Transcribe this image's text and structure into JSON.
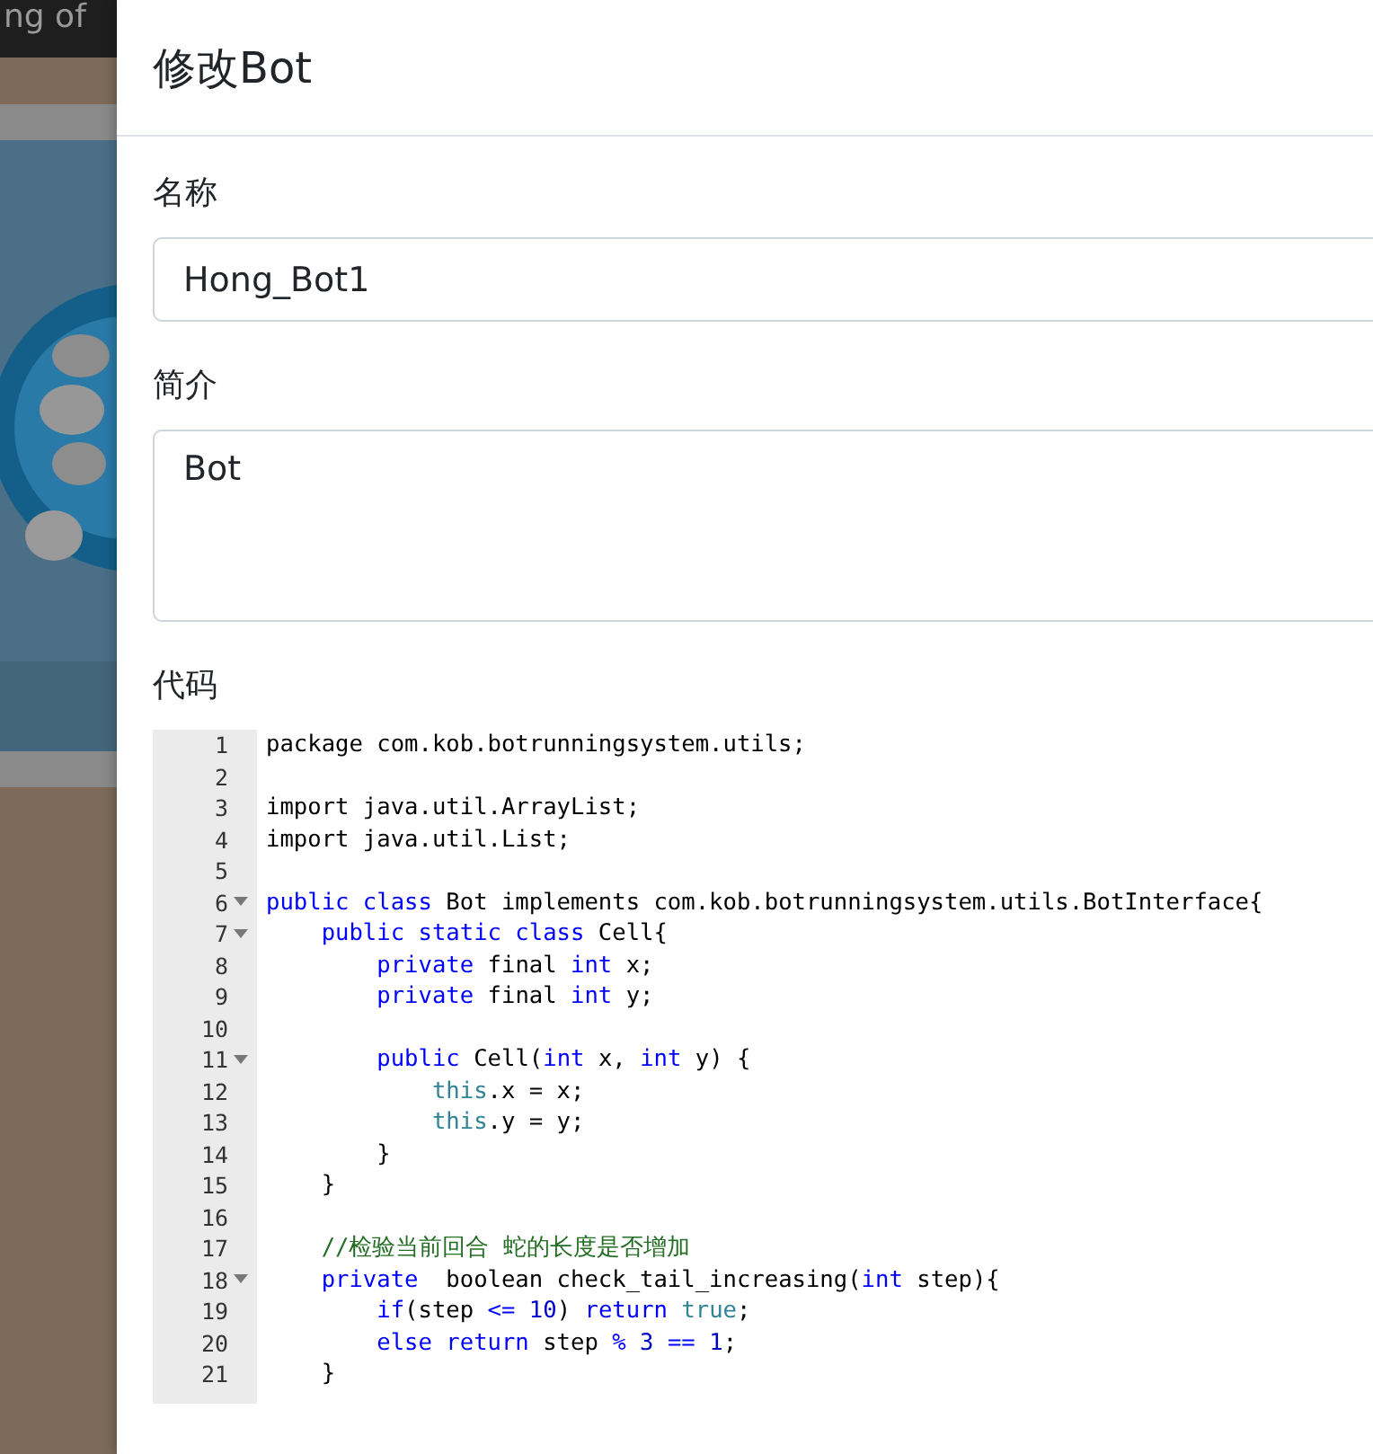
{
  "backdrop": {
    "navbar_text": "ng of"
  },
  "modal": {
    "title": "修改Bot",
    "fields": [
      {
        "label": "名称",
        "kind": "input",
        "value": "Hong_Bot1"
      },
      {
        "label": "简介",
        "kind": "textarea",
        "value": "Bot"
      }
    ],
    "code_label": "代码",
    "code_lines": [
      {
        "number": "1",
        "foldable": false,
        "tokens": [
          {
            "kind": "plain",
            "text": "package com.kob.botrunningsystem.utils;"
          }
        ]
      },
      {
        "number": "2",
        "foldable": false
      },
      {
        "number": "3",
        "foldable": false,
        "tokens": [
          {
            "kind": "plain",
            "text": "import java.util.ArrayList;"
          }
        ]
      },
      {
        "number": "4",
        "foldable": false,
        "tokens": [
          {
            "kind": "plain",
            "text": "import java.util.List;"
          }
        ]
      },
      {
        "number": "5",
        "foldable": false
      },
      {
        "number": "6",
        "foldable": true,
        "tokens": [
          {
            "kind": "keyword",
            "text": "public class"
          },
          {
            "kind": "plain",
            "text": " Bot implements com.kob.botrunningsystem.utils.BotInterface{"
          }
        ]
      },
      {
        "number": "7",
        "foldable": true,
        "tokens": [
          {
            "kind": "keyword",
            "text": "    public static class"
          },
          {
            "kind": "plain",
            "text": " Cell{"
          }
        ]
      },
      {
        "number": "8",
        "foldable": false,
        "tokens": [
          {
            "kind": "keyword",
            "text": "        private"
          },
          {
            "kind": "plain",
            "text": " final "
          },
          {
            "kind": "keyword",
            "text": "int"
          },
          {
            "kind": "plain",
            "text": " x;"
          }
        ]
      },
      {
        "number": "9",
        "foldable": false,
        "tokens": [
          {
            "kind": "keyword",
            "text": "        private"
          },
          {
            "kind": "plain",
            "text": " final "
          },
          {
            "kind": "keyword",
            "text": "int"
          },
          {
            "kind": "plain",
            "text": " y;"
          }
        ]
      },
      {
        "number": "10",
        "foldable": false
      },
      {
        "number": "11",
        "foldable": true,
        "tokens": [
          {
            "kind": "keyword",
            "text": "        public"
          },
          {
            "kind": "plain",
            "text": " Cell("
          },
          {
            "kind": "keyword",
            "text": "int"
          },
          {
            "kind": "plain",
            "text": " x, "
          },
          {
            "kind": "keyword",
            "text": "int"
          },
          {
            "kind": "plain",
            "text": " y) {"
          }
        ]
      },
      {
        "number": "12",
        "foldable": false,
        "tokens": [
          {
            "kind": "builtin",
            "text": "            this"
          },
          {
            "kind": "plain",
            "text": ".x = x;"
          }
        ]
      },
      {
        "number": "13",
        "foldable": false,
        "tokens": [
          {
            "kind": "builtin",
            "text": "            this"
          },
          {
            "kind": "plain",
            "text": ".y = y;"
          }
        ]
      },
      {
        "number": "14",
        "foldable": false,
        "tokens": [
          {
            "kind": "plain",
            "text": "        }"
          }
        ]
      },
      {
        "number": "15",
        "foldable": false,
        "tokens": [
          {
            "kind": "plain",
            "text": "    }"
          }
        ]
      },
      {
        "number": "16",
        "foldable": false
      },
      {
        "number": "17",
        "foldable": false,
        "tokens": [
          {
            "kind": "comment",
            "text": "    //检验当前回合 蛇的长度是否增加"
          }
        ]
      },
      {
        "number": "18",
        "foldable": true,
        "tokens": [
          {
            "kind": "keyword",
            "text": "    private"
          },
          {
            "kind": "plain",
            "text": "  boolean check_tail_increasing("
          },
          {
            "kind": "keyword",
            "text": "int"
          },
          {
            "kind": "plain",
            "text": " step){"
          }
        ]
      },
      {
        "number": "19",
        "foldable": false,
        "tokens": [
          {
            "kind": "keyword",
            "text": "        if"
          },
          {
            "kind": "plain",
            "text": "(step "
          },
          {
            "kind": "keyword",
            "text": "<="
          },
          {
            "kind": "number",
            "text": " 10"
          },
          {
            "kind": "plain",
            "text": ") "
          },
          {
            "kind": "keyword",
            "text": "return"
          },
          {
            "kind": "builtin",
            "text": " true"
          },
          {
            "kind": "plain",
            "text": ";"
          }
        ]
      },
      {
        "number": "20",
        "foldable": false,
        "tokens": [
          {
            "kind": "keyword",
            "text": "        else return"
          },
          {
            "kind": "plain",
            "text": " step "
          },
          {
            "kind": "keyword",
            "text": "%"
          },
          {
            "kind": "number",
            "text": " 3"
          },
          {
            "kind": "keyword",
            "text": " =="
          },
          {
            "kind": "number",
            "text": " 1"
          },
          {
            "kind": "plain",
            "text": ";"
          }
        ]
      },
      {
        "number": "21",
        "foldable": false,
        "tokens": [
          {
            "kind": "plain",
            "text": "    }"
          }
        ]
      }
    ]
  }
}
